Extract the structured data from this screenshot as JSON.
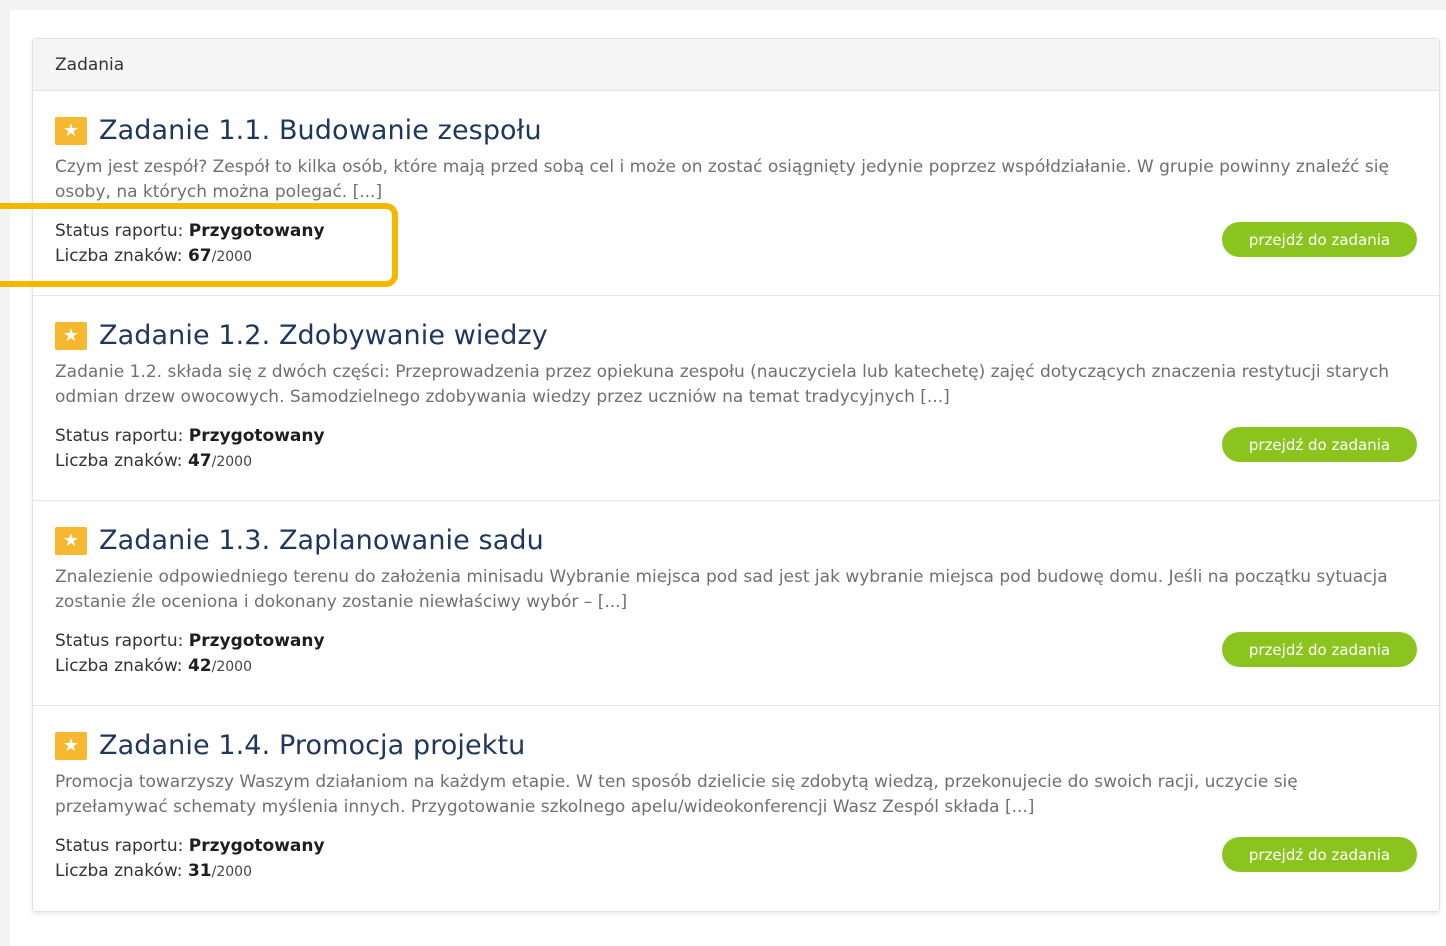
{
  "panel": {
    "title": "Zadania"
  },
  "labels": {
    "status": "Status raportu:",
    "chars": "Liczba znaków:",
    "max_chars": "/2000",
    "button": "przejdź do zadania"
  },
  "tasks": [
    {
      "title": "Zadanie 1.1. Budowanie zespołu",
      "description": "Czym jest zespół? Zespół to kilka osób, które mają przed sobą cel i może on zostać osiągnięty jedynie poprzez współdziałanie. W grupie powinny znaleźć się osoby, na których można polegać. [...]",
      "status": "Przygotowany",
      "chars": "67"
    },
    {
      "title": "Zadanie 1.2. Zdobywanie wiedzy",
      "description": "Zadanie 1.2. składa się z dwóch części: Przeprowadzenia przez opiekuna zespołu (nauczyciela lub katechetę) zajęć dotyczących znaczenia restytucji starych odmian drzew owocowych. Samodzielnego zdobywania wiedzy przez uczniów na temat tradycyjnych [...]",
      "status": "Przygotowany",
      "chars": "47"
    },
    {
      "title": "Zadanie 1.3. Zaplanowanie sadu",
      "description": "Znalezienie odpowiedniego terenu do założenia minisadu Wybranie miejsca pod sad jest jak wybranie miejsca pod budowę domu. Jeśli na początku sytuacja zostanie źle oceniona i dokonany zostanie niewłaściwy wybór – [...]",
      "status": "Przygotowany",
      "chars": "42"
    },
    {
      "title": "Zadanie 1.4. Promocja projektu",
      "description": "Promocja towarzyszy Waszym działaniom na każdym etapie. W ten sposób dzielicie się zdobytą wiedzą, przekonujecie do swoich racji, uczycie się przełamywać schematy myślenia innych. Przygotowanie szkolnego apelu/wideokonferencji Wasz Zespól składa [...]",
      "status": "Przygotowany",
      "chars": "31"
    }
  ],
  "colors": {
    "title": "#20365e",
    "star_badge": "#f5b82e",
    "button": "#8cc41f",
    "highlight": "#f5b800"
  }
}
